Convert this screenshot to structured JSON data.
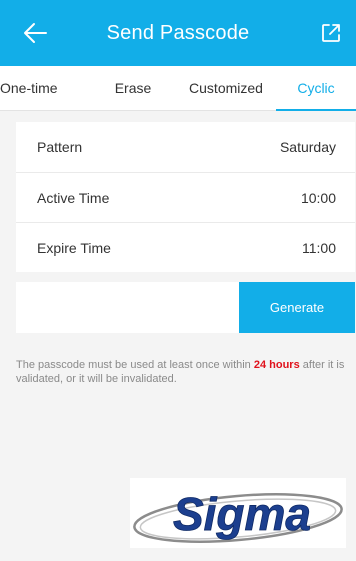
{
  "header": {
    "title": "Send Passcode",
    "back_icon": "arrow-left-icon",
    "share_icon": "share-out-icon",
    "color": "#12aee8"
  },
  "tabs": [
    {
      "label": "One-time",
      "active": false
    },
    {
      "label": "Erase",
      "active": false
    },
    {
      "label": "Customized",
      "active": false
    },
    {
      "label": "Cyclic",
      "active": true
    }
  ],
  "settings": [
    {
      "label": "Pattern",
      "value": "Saturday"
    },
    {
      "label": "Active Time",
      "value": "10:00"
    },
    {
      "label": "Expire Time",
      "value": "11:00"
    }
  ],
  "generate_label": "Generate",
  "note": {
    "before": "The passcode must be used at least once within ",
    "highlight": "24 hours",
    "after": " after it is validated, or it will be invalidated.",
    "highlight_color": "#e0121c"
  },
  "logo": {
    "text": "Sigma"
  }
}
